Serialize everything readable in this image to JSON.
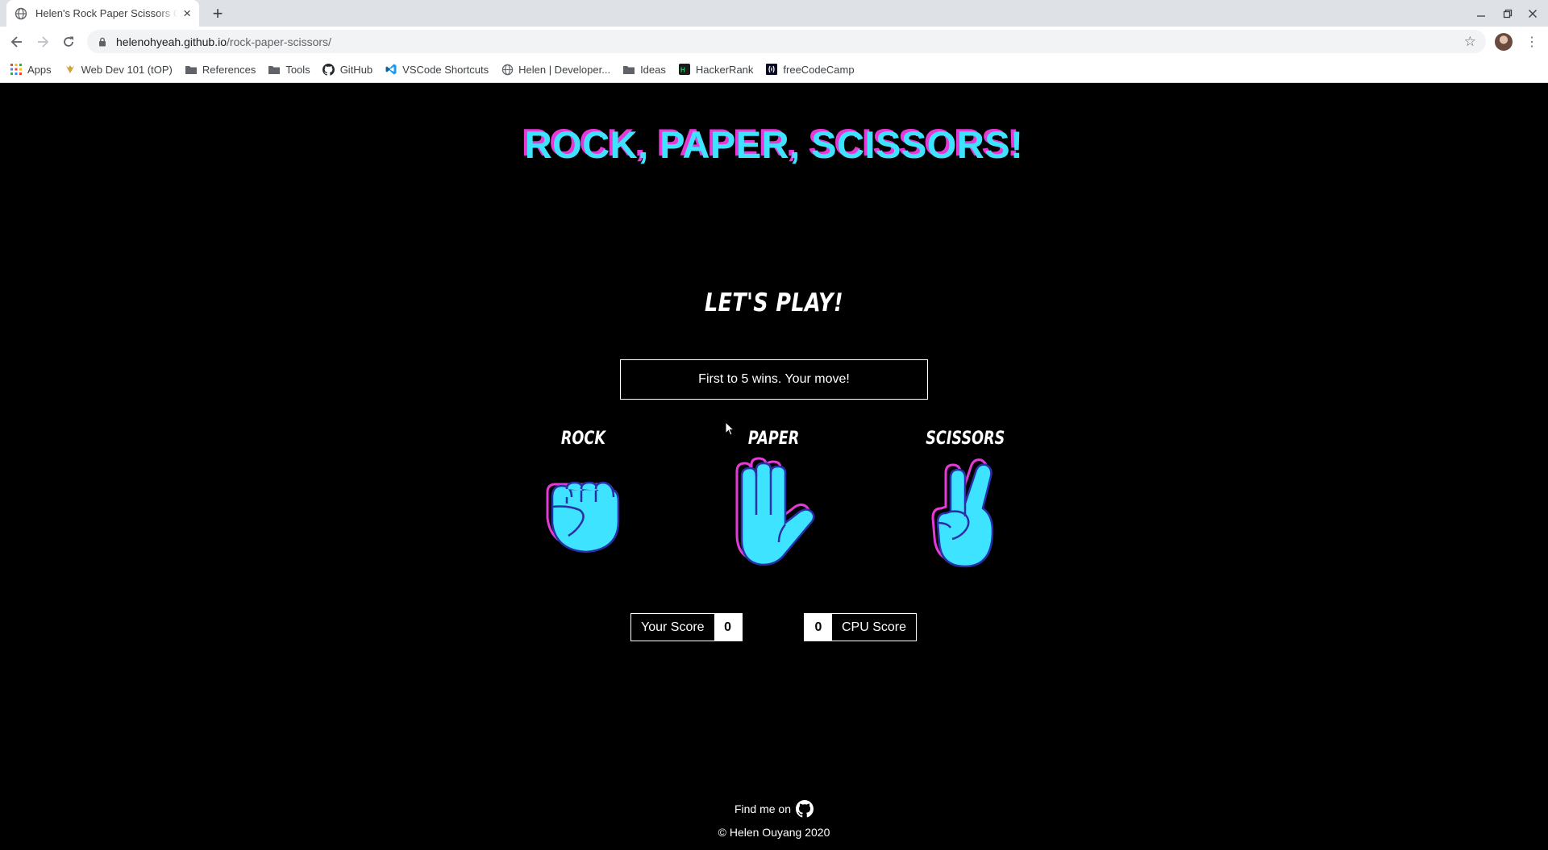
{
  "browser": {
    "tab_title": "Helen's Rock Paper Scissors Game",
    "url_host": "helenohyeah.github.io",
    "url_path": "/rock-paper-scissors/",
    "bookmarks": [
      {
        "label": "Apps",
        "icon": "apps-grid-icon"
      },
      {
        "label": "Web Dev 101 (tOP)",
        "icon": "odin-icon"
      },
      {
        "label": "References",
        "icon": "folder-icon"
      },
      {
        "label": "Tools",
        "icon": "folder-icon"
      },
      {
        "label": "GitHub",
        "icon": "github-icon"
      },
      {
        "label": "VSCode Shortcuts",
        "icon": "vscode-icon"
      },
      {
        "label": "Helen | Developer...",
        "icon": "globe-icon"
      },
      {
        "label": "Ideas",
        "icon": "folder-icon"
      },
      {
        "label": "HackerRank",
        "icon": "hackerrank-icon"
      },
      {
        "label": "freeCodeCamp",
        "icon": "freecodecamp-icon"
      }
    ]
  },
  "game": {
    "title": "ROCK, PAPER, SCISSORS!",
    "subtitle": "LET'S PLAY!",
    "message": "First to 5 wins. Your move!",
    "choices": [
      {
        "label": "ROCK",
        "icon": "rock-fist-icon"
      },
      {
        "label": "PAPER",
        "icon": "paper-hand-icon"
      },
      {
        "label": "SCISSORS",
        "icon": "scissors-peace-icon"
      }
    ],
    "your_score_label": "Your Score",
    "your_score": "0",
    "cpu_score_label": "CPU Score",
    "cpu_score": "0"
  },
  "footer": {
    "find_me": "Find me on",
    "copyright": "© Helen Ouyang 2020"
  },
  "colors": {
    "accent_cyan": "#3ee3ff",
    "accent_magenta": "#e63ad8",
    "background": "#000000"
  }
}
